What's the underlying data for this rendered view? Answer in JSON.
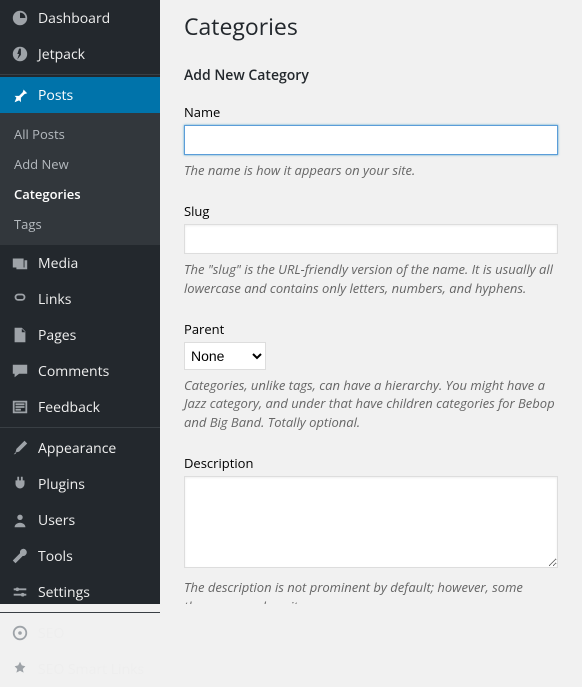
{
  "sidebar": {
    "dashboard": "Dashboard",
    "jetpack": "Jetpack",
    "posts": "Posts",
    "posts_sub": {
      "all": "All Posts",
      "add": "Add New",
      "categories": "Categories",
      "tags": "Tags"
    },
    "media": "Media",
    "links": "Links",
    "pages": "Pages",
    "comments": "Comments",
    "feedback": "Feedback",
    "appearance": "Appearance",
    "plugins": "Plugins",
    "users": "Users",
    "tools": "Tools",
    "settings": "Settings",
    "seo": "SEO",
    "seo_smart": "SEO Smart Links"
  },
  "page": {
    "title": "Categories",
    "heading": "Add New Category"
  },
  "form": {
    "name": {
      "label": "Name",
      "value": "",
      "hint": "The name is how it appears on your site."
    },
    "slug": {
      "label": "Slug",
      "value": "",
      "hint": "The \"slug\" is the URL-friendly version of the name. It is usually all lowercase and contains only letters, numbers, and hyphens."
    },
    "parent": {
      "label": "Parent",
      "selected": "None",
      "hint": "Categories, unlike tags, can have a hierarchy. You might have a Jazz category, and under that have children categories for Bebop and Big Band. Totally optional."
    },
    "description": {
      "label": "Description",
      "value": "",
      "hint": "The description is not prominent by default; however, some themes may show it."
    }
  }
}
